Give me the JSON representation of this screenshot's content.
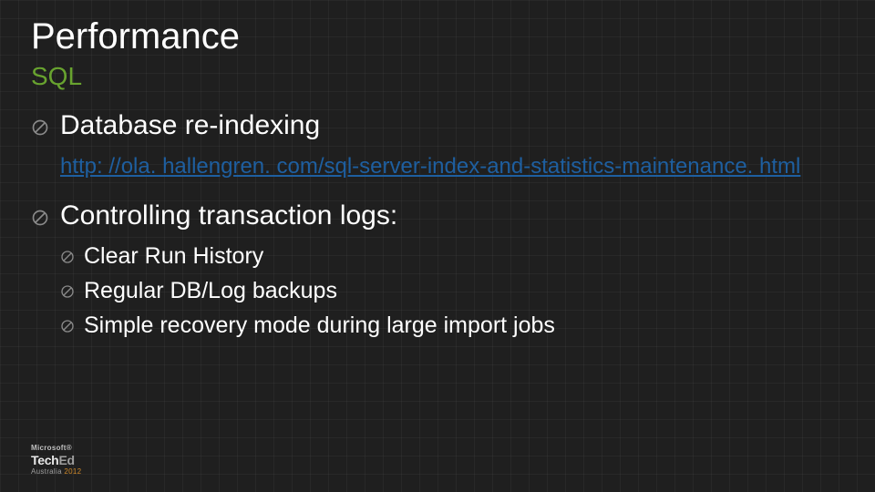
{
  "title": "Performance",
  "subtitle": "SQL",
  "bullets": {
    "item1": "Database re-indexing",
    "link": "http: //ola. hallengren. com/sql-server-index-and-statistics-maintenance. html",
    "item2": "Controlling transaction logs:",
    "sub1": "Clear Run History",
    "sub2": "Regular DB/Log backups",
    "sub3": "Simple recovery mode during large import jobs"
  },
  "footer": {
    "ms": "Microsoft®",
    "tech": "Tech",
    "ed": "Ed",
    "au": "Australia ",
    "year": "2012"
  }
}
